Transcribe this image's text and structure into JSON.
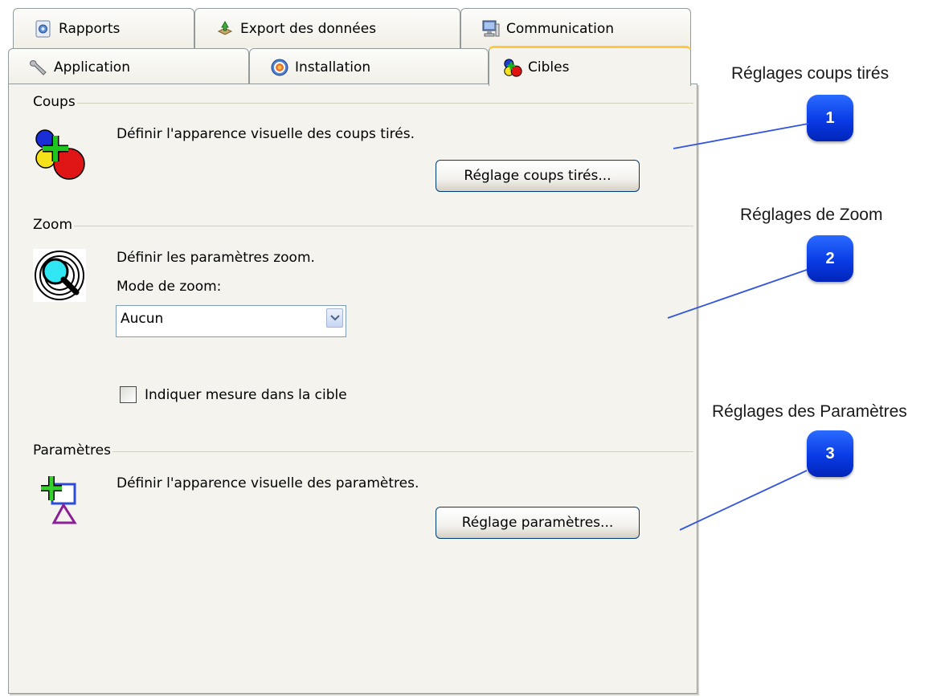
{
  "tabs": {
    "row_back": [
      {
        "label": "Rapports",
        "icon": "report-icon"
      },
      {
        "label": "Export des données",
        "icon": "export-icon"
      },
      {
        "label": "Communication",
        "icon": "computer-icon"
      }
    ],
    "row_front": [
      {
        "label": "Application",
        "icon": "wrench-icon"
      },
      {
        "label": "Installation",
        "icon": "target-icon"
      },
      {
        "label": "Cibles",
        "icon": "shots-icon",
        "active": true
      }
    ]
  },
  "coups": {
    "title": "Coups",
    "description": "Définir l'apparence visuelle des coups tirés.",
    "button_label": "Réglage coups tirés..."
  },
  "zoom": {
    "title": "Zoom",
    "description": "Définir les paramètres zoom.",
    "mode_label": "Mode de zoom:",
    "mode_value": "Aucun",
    "checkbox_label": "Indiquer mesure dans la cible",
    "checkbox_checked": false
  },
  "parametres": {
    "title": "Paramètres",
    "description": "Définir l'apparence visuelle des paramètres.",
    "button_label": "Réglage paramètres..."
  },
  "callouts": [
    {
      "number": "1",
      "label": "Réglages coups tirés"
    },
    {
      "number": "2",
      "label": "Réglages de Zoom"
    },
    {
      "number": "3",
      "label": "Réglages des Paramètres"
    }
  ],
  "colors": {
    "panel_bg": "#f4f3ee",
    "tab_border": "#919b9c",
    "active_tab_accent": "#ffc83c",
    "button_border": "#003c74",
    "badge_blue": "#0a3be6",
    "callout_line": "#3355dd"
  }
}
